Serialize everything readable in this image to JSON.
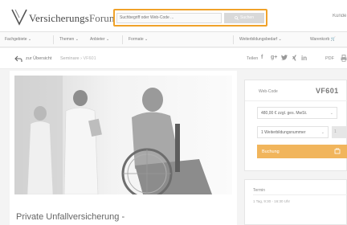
{
  "header": {
    "logo_main": "Versicherungs",
    "logo_suffix": "Forum",
    "search": {
      "placeholder": "Suchbegriff oder Web-Code ...",
      "button_label": "Suchen"
    },
    "right_label": "Kunde"
  },
  "nav": {
    "left_items": [
      "Fachgebiete",
      "Themen",
      "Anbieter",
      "Formate"
    ],
    "right_items": [
      "Weiterbildungsbedarf",
      "Warenkorb"
    ]
  },
  "breadcrumb": {
    "back_label": "zur Übersicht",
    "path": "Seminare",
    "current": "VF601"
  },
  "share": {
    "label": "Teilen",
    "icons": [
      "f",
      "g+",
      "tw",
      "x",
      "in"
    ],
    "pdf_label": "PDF"
  },
  "main": {
    "title": "Private Unfallversicherung -"
  },
  "booking": {
    "webcode_label": "Web-Code",
    "webcode_value": "VF601",
    "price_option": "480,00 € zzgl. ges. MwSt.",
    "participant_option": "1 Weiterbildungsnummer",
    "qty_value": "1",
    "book_label": "Buchung"
  },
  "dates": {
    "title": "Termin",
    "items": [
      "1 Tag, 9:30 - 16:30 Uhr"
    ]
  },
  "colors": {
    "accent": "#f0a22a",
    "button": "#f1b55c"
  }
}
